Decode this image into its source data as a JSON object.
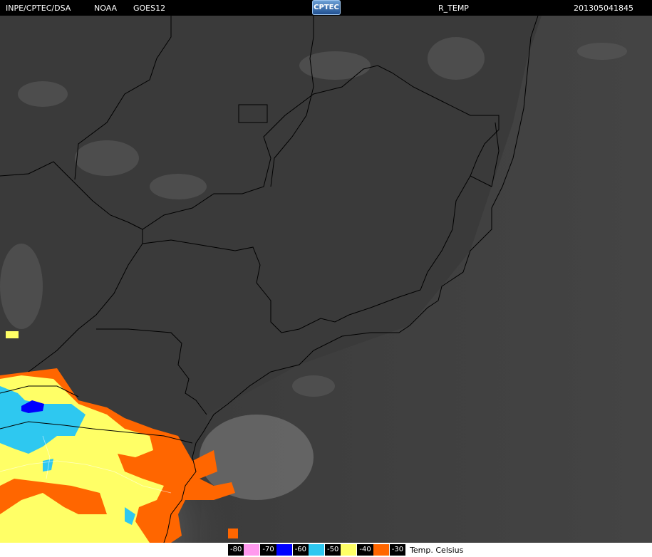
{
  "header": {
    "agency": "INPE/CPTEC/DSA",
    "source": "NOAA",
    "satellite": "GOES12",
    "logo_text": "CPTEC",
    "product": "R_TEMP",
    "timestamp": "201305041845"
  },
  "legend": {
    "items": [
      {
        "label": "-80",
        "color": "#ff99ee"
      },
      {
        "label": "-70",
        "color": "#0000ff"
      },
      {
        "label": "-60",
        "color": "#2ec8f0"
      },
      {
        "label": "-50",
        "color": "#ffff66"
      },
      {
        "label": "-40",
        "color": "#ff6600"
      },
      {
        "label": "-30",
        "color": "#000000"
      }
    ],
    "unit": "Temp. Celsius"
  },
  "map": {
    "background": "#3a3a3a",
    "ocean": "#424242",
    "border_color": "#000000"
  }
}
